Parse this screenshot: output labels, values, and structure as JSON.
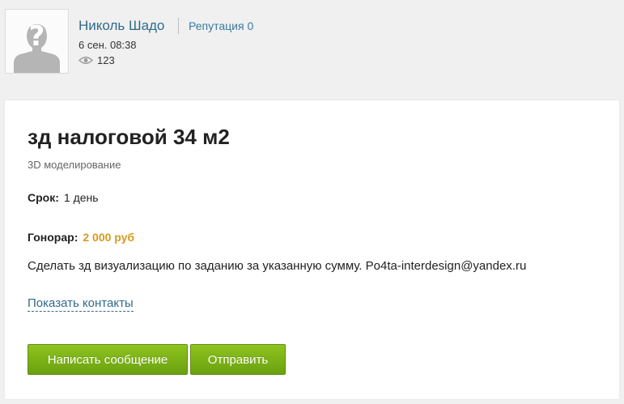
{
  "author": {
    "name": "Николь Шадо",
    "reputation": "Репутация 0",
    "date": "6 сен. 08:38",
    "views": "123"
  },
  "icons": {
    "avatar": "default-avatar-icon",
    "views": "eye-icon"
  },
  "job": {
    "title": "зд налоговой 34 м2",
    "category": "3D моделирование",
    "term_label": "Срок:",
    "term_value": "1 день",
    "fee_label": "Гонорар:",
    "fee_value": "2 000 руб",
    "description": "Сделать зд визуализацию по заданию за указанную сумму. Po4ta-interdesign@yandex.ru"
  },
  "actions": {
    "show_contacts": "Показать контакты",
    "write_message": "Написать сообщение",
    "send": "Отправить"
  },
  "colors": {
    "page_bg": "#f0f0f0",
    "link": "#2f6b8c",
    "fee": "#d79a22",
    "button_green": "#7cb518"
  }
}
